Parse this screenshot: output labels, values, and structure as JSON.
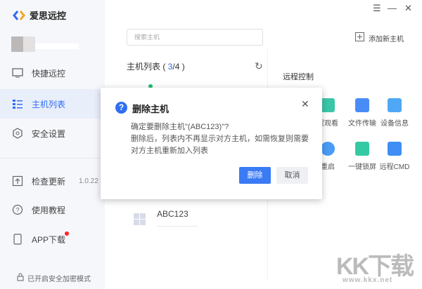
{
  "app": {
    "title": "爱思远控"
  },
  "window": {
    "min": "☰",
    "max": "—",
    "close": "✕"
  },
  "sidebar": {
    "items": [
      {
        "label": "快捷远控"
      },
      {
        "label": "主机列表",
        "active": true
      },
      {
        "label": "安全设置"
      },
      {
        "label": "检查更新",
        "version": "1.0.22"
      },
      {
        "label": "使用教程"
      },
      {
        "label": "APP下载"
      }
    ],
    "footer": "已开启安全加密模式"
  },
  "main": {
    "search_placeholder": "搜索主机",
    "add_host": "添加新主机",
    "list_title_prefix": "主机列表 ( ",
    "online": "3",
    "total": "/4 )",
    "hosts": [
      {
        "name": "ABC123"
      }
    ]
  },
  "remote": {
    "title": "远程控制",
    "tools": [
      {
        "label": "程观看",
        "color": "#3cc6a8"
      },
      {
        "label": "文件传输",
        "color": "#4a8cf7"
      },
      {
        "label": "设备信息",
        "color": "#4fa8f5"
      },
      {
        "label": "重启",
        "color": "#4a9cf7"
      },
      {
        "label": "一键锁屏",
        "color": "#35c9a3"
      },
      {
        "label": "远程CMD",
        "color": "#3f8ef5"
      }
    ]
  },
  "dialog": {
    "title": "删除主机",
    "line1": "确定要删除主机\"(ABC123)\"?",
    "line2": "删除后，列表内不再显示对方主机，如需恢复则需要对方主机重新加入列表",
    "confirm": "删除",
    "cancel": "取消"
  },
  "watermark": {
    "text": "KK下载",
    "url": "www.kkx.net"
  }
}
